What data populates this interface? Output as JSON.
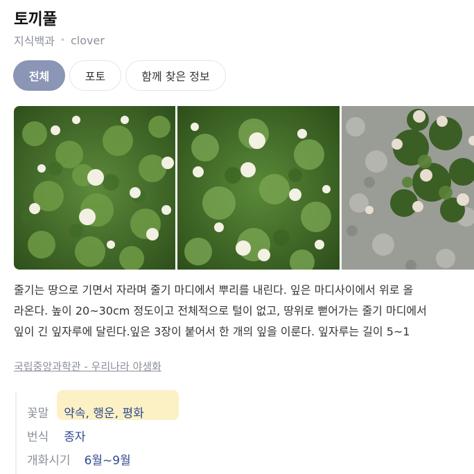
{
  "header": {
    "title": "토끼풀",
    "category": "지식백과",
    "subtitle": "clover"
  },
  "tabs": [
    {
      "label": "전체",
      "active": true
    },
    {
      "label": "포토",
      "active": false
    },
    {
      "label": "함께 찾은 정보",
      "active": false
    }
  ],
  "gallery": {
    "images": [
      "clover-plants-photo",
      "clover-flowers-photo",
      "clover-on-gravel-photo"
    ]
  },
  "description": {
    "lines": [
      "줄기는 땅으로 기면서 자라며 줄기 마디에서 뿌리를 내린다. 잎은 마디사이에서 위로 올",
      "라온다. 높이 20~30cm 정도이고 전체적으로 털이 없고, 땅위로 뻗어가는 줄기 마디에서",
      "잎이 긴 잎자루에 달린다.잎은 3장이 붙어서 한 개의 잎을 이룬다. 잎자루는 길이 5~1"
    ]
  },
  "source": {
    "label": "국립중앙과학관 - 우리나라 야생화"
  },
  "info": {
    "rows": [
      {
        "key": "꽃말",
        "value": "약속, 행운, 평화"
      },
      {
        "key": "번식",
        "value": "종자"
      },
      {
        "key": "개화시기",
        "value": "6월~9월"
      }
    ]
  },
  "colors": {
    "active_tab": "#8b95b5",
    "highlight": "#fbf1c5",
    "value_text": "#2e4a8f",
    "muted_text": "#8a8f99"
  }
}
